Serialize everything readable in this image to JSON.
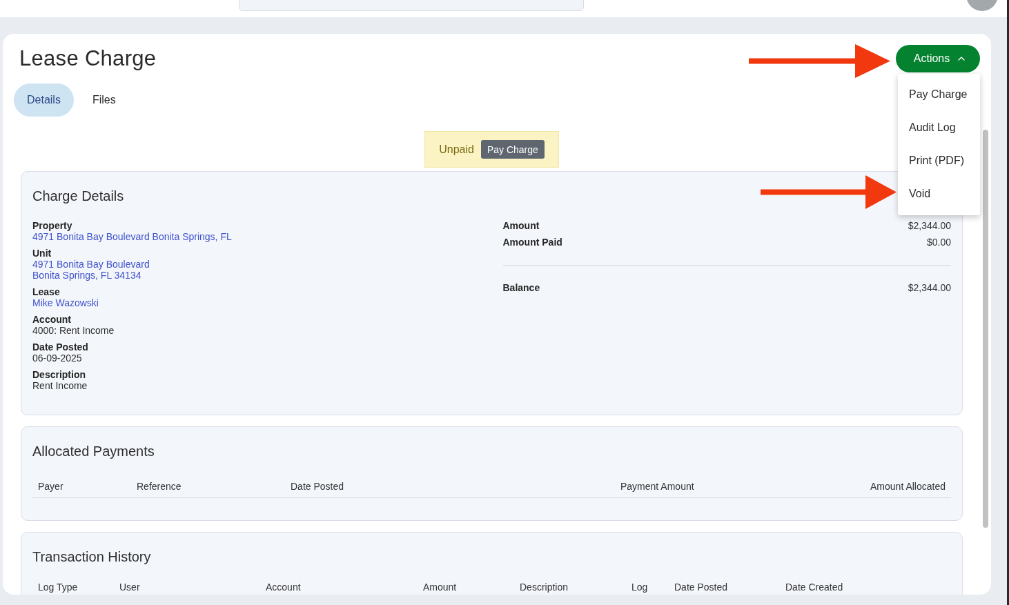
{
  "page": {
    "title": "Lease Charge"
  },
  "tabs": [
    {
      "label": "Details",
      "selected": true
    },
    {
      "label": "Files",
      "selected": false
    }
  ],
  "actions": {
    "label": "Actions",
    "expanded": true,
    "menu": [
      {
        "label": "Pay Charge"
      },
      {
        "label": "Audit Log"
      },
      {
        "label": "Print (PDF)"
      },
      {
        "label": "Void"
      }
    ]
  },
  "status_banner": {
    "status": "Unpaid",
    "button": "Pay Charge"
  },
  "charge_details": {
    "title": "Charge Details",
    "fields": [
      {
        "label": "Property",
        "value": "4971 Bonita Bay Boulevard Bonita Springs, FL",
        "link": true
      },
      {
        "label": "Unit",
        "value": "4971 Bonita Bay Boulevard\nBonita Springs, FL 34134",
        "link": true
      },
      {
        "label": "Lease",
        "value": "Mike Wazowski",
        "link": true
      },
      {
        "label": "Account",
        "value": "4000: Rent Income",
        "link": false
      },
      {
        "label": "Date Posted",
        "value": "06-09-2025",
        "link": false
      },
      {
        "label": "Description",
        "value": "Rent Income",
        "link": false
      }
    ],
    "summary": [
      {
        "label": "Amount",
        "value": "$2,344.00"
      },
      {
        "label": "Amount Paid",
        "value": "$0.00"
      }
    ],
    "balance": {
      "label": "Balance",
      "value": "$2,344.00"
    }
  },
  "allocated_payments": {
    "title": "Allocated Payments",
    "columns": [
      "Payer",
      "Reference",
      "Date Posted",
      "Payment Amount",
      "Amount Allocated"
    ]
  },
  "transaction_history": {
    "title": "Transaction History",
    "columns": [
      "Log Type",
      "User",
      "Account",
      "Amount",
      "Description",
      "Log",
      "Date Posted",
      "Date Created"
    ]
  }
}
